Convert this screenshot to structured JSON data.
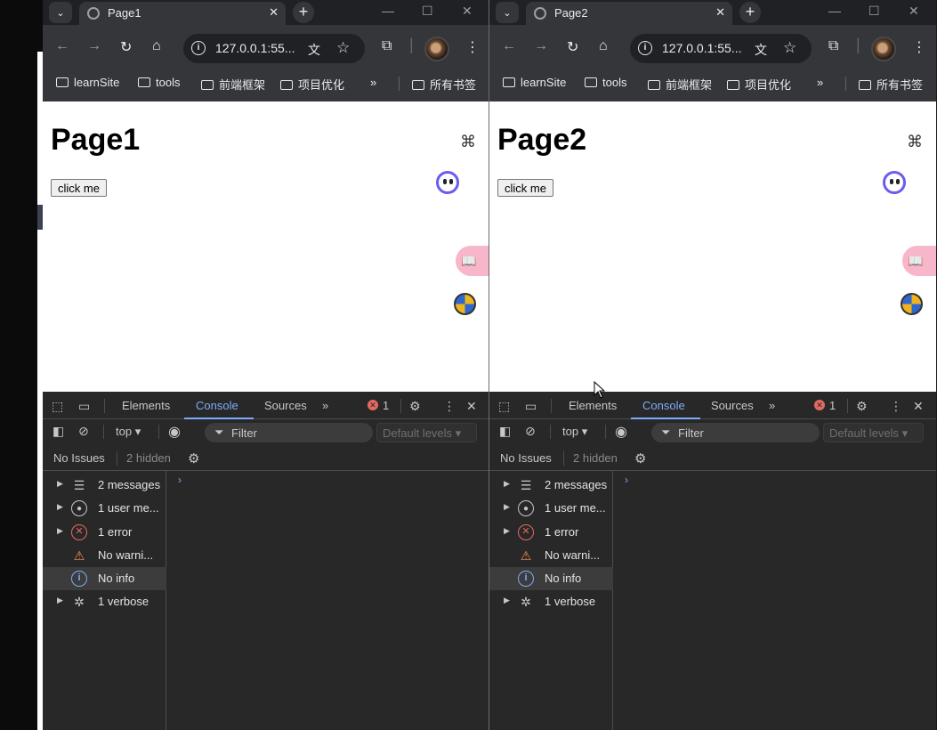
{
  "windows": [
    {
      "tab_title": "Page1",
      "url": "127.0.0.1:55...",
      "page_heading": "Page1",
      "page_button": "click me"
    },
    {
      "tab_title": "Page2",
      "url": "127.0.0.1:55...",
      "page_heading": "Page2",
      "page_button": "click me"
    }
  ],
  "bookmarks": [
    "learnSite",
    "tools",
    "前端框架",
    "项目优化",
    "所有书签"
  ],
  "bookmarks_more": "»",
  "devtools": {
    "tabs": [
      "Elements",
      "Console",
      "Sources"
    ],
    "active_tab": "Console",
    "more_tabs": "»",
    "error_count": "1",
    "context": "top",
    "filter_placeholder": "Filter",
    "levels": "Default levels",
    "issues": "No Issues",
    "hidden": "2 hidden",
    "prompt": "›",
    "sidebar": [
      {
        "label": "2 messages",
        "icon": "list-icon",
        "expandable": true
      },
      {
        "label": "1 user me...",
        "icon": "user-icon",
        "expandable": true
      },
      {
        "label": "1 error",
        "icon": "error-icon",
        "expandable": true
      },
      {
        "label": "No warni...",
        "icon": "warning-icon",
        "expandable": false
      },
      {
        "label": "No info",
        "icon": "info-icon",
        "expandable": false,
        "selected": true
      },
      {
        "label": "1 verbose",
        "icon": "bug-icon",
        "expandable": true
      }
    ]
  },
  "colors": {
    "chrome_dark": "#202124",
    "toolbar": "#35363a",
    "devtools_bg": "#282828",
    "accent_blue": "#7cacf8",
    "error_red": "#e46962"
  }
}
